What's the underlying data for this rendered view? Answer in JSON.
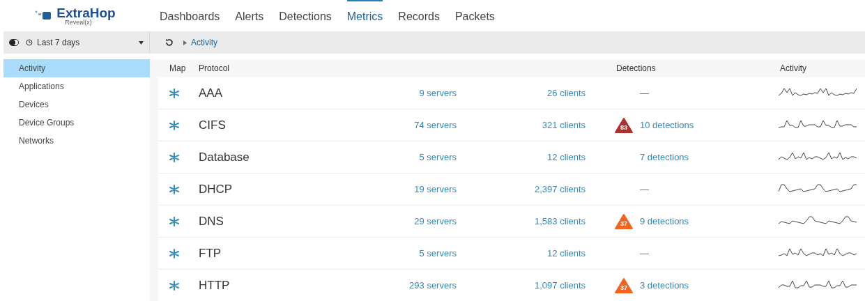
{
  "logo": {
    "name": "ExtraHop",
    "subtitle": "Reveal(x)"
  },
  "nav": [
    {
      "label": "Dashboards",
      "selected": false
    },
    {
      "label": "Alerts",
      "selected": false
    },
    {
      "label": "Detections",
      "selected": false
    },
    {
      "label": "Metrics",
      "selected": true
    },
    {
      "label": "Records",
      "selected": false
    },
    {
      "label": "Packets",
      "selected": false
    }
  ],
  "toolbar": {
    "time_range": "Last 7 days",
    "breadcrumb": "Activity"
  },
  "sidebar": {
    "items": [
      {
        "label": "Activity",
        "selected": true
      },
      {
        "label": "Applications",
        "selected": false
      },
      {
        "label": "Devices",
        "selected": false
      },
      {
        "label": "Device Groups",
        "selected": false
      },
      {
        "label": "Networks",
        "selected": false
      }
    ]
  },
  "table": {
    "columns": [
      "Map",
      "Protocol",
      "Detections",
      "Activity"
    ],
    "rows": [
      {
        "protocol": "AAA",
        "servers": "9 servers",
        "clients": "26 clients",
        "detections": "—"
      },
      {
        "protocol": "CIFS",
        "servers": "74 servers",
        "clients": "321 clients",
        "badge": {
          "score": "83",
          "color": "#a83232"
        },
        "detections": "10 detections"
      },
      {
        "protocol": "Database",
        "servers": "5 servers",
        "clients": "12 clients",
        "detections": "7 detections"
      },
      {
        "protocol": "DHCP",
        "servers": "19 servers",
        "clients": "2,397 clients",
        "detections": "—"
      },
      {
        "protocol": "DNS",
        "servers": "29 servers",
        "clients": "1,583 clients",
        "badge": {
          "score": "37",
          "color": "#f06424"
        },
        "detections": "9 detections"
      },
      {
        "protocol": "FTP",
        "servers": "5 servers",
        "clients": "12 clients",
        "detections": "—"
      },
      {
        "protocol": "HTTP",
        "servers": "293 servers",
        "clients": "1,097 clients",
        "badge": {
          "score": "37",
          "color": "#f06424"
        },
        "detections": "3 detections"
      }
    ]
  }
}
